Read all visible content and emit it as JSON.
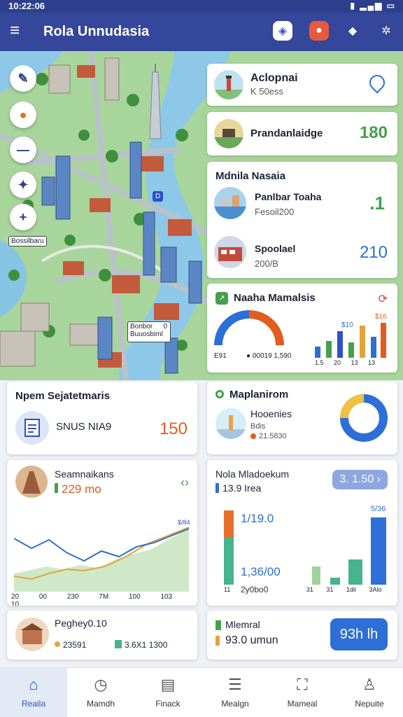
{
  "status_bar": {
    "time": "10:22:06",
    "icons": "▮ ▂▄▆ ▭"
  },
  "app_bar": {
    "title": "Rola Unnudasia"
  },
  "map": {
    "controls": [
      "✎",
      "●",
      "—",
      "✦",
      "+"
    ],
    "scale_label": "Bossilbaru",
    "pin_label": "D",
    "callout_line1": "Bonbor",
    "callout_num": "0",
    "callout_line2": "Buuosbiml"
  },
  "cards": {
    "adlopnai": {
      "title": "Aclopnai",
      "sub": "K 50ess"
    },
    "pranda": {
      "title": "Prandanlaidge",
      "value": "180"
    },
    "media": {
      "title": "Mdnila Nasaia",
      "row1_title": "Panlbar Toaha",
      "row1_sub": "Fesoil200",
      "row1_value": ".1",
      "row2_title": "Spoolael",
      "row2_sub": "200/B",
      "row2_value": "210"
    },
    "nasha": {
      "title": "Naaha Mamalsis",
      "gauge_left": "E91",
      "gauge_center": "● 00019 1,590",
      "bar_label1": "$10",
      "bar_label2": "$16",
      "bar_axis": [
        "1.5",
        "20",
        "13",
        "13"
      ]
    },
    "npem": {
      "title": "Npem Sejatetmaris",
      "sub": "SNUS NIA9",
      "value": "150"
    },
    "maplanirom": {
      "title": "Maplanirom",
      "sub1": "Hooenies",
      "sub2": "Bdis",
      "sub3": "21.5830"
    },
    "seam": {
      "title": "Seamnaikans",
      "value": "229 mo",
      "peak_label": "$/84",
      "x_ticks": [
        "20",
        "00",
        "230",
        "7M",
        "100",
        "103",
        "10"
      ]
    },
    "nola": {
      "title": "Nola Mladoekum",
      "sub": "13.9 Irea",
      "badge": "3. 1.50 ›",
      "label1": "1/19.0",
      "label2": "1,36/00",
      "label3": "2y0bo0",
      "label4": "5/36",
      "axis": [
        "11",
        "31",
        "31",
        "1dil",
        "3Alo"
      ]
    },
    "peghey": {
      "title": "Peghey0.10",
      "sub": "23591",
      "sub2": "3.6X1 1300"
    },
    "mlemral": {
      "title": "Mlemral",
      "value": "93.0 umun",
      "button": "93h lh"
    }
  },
  "nav": {
    "items": [
      {
        "label": "Reaila",
        "icon": "home-icon"
      },
      {
        "label": "Mamdh",
        "icon": "clock-icon"
      },
      {
        "label": "Finack",
        "icon": "document-icon"
      },
      {
        "label": "Mealgn",
        "icon": "notes-icon"
      },
      {
        "label": "Mameal",
        "icon": "map-icon"
      },
      {
        "label": "Nepuite",
        "icon": "person-icon"
      }
    ]
  },
  "colors": {
    "primary": "#34479b",
    "accent_blue": "#2d6fd6",
    "accent_orange": "#e35b1e",
    "accent_green": "#45a04a"
  }
}
